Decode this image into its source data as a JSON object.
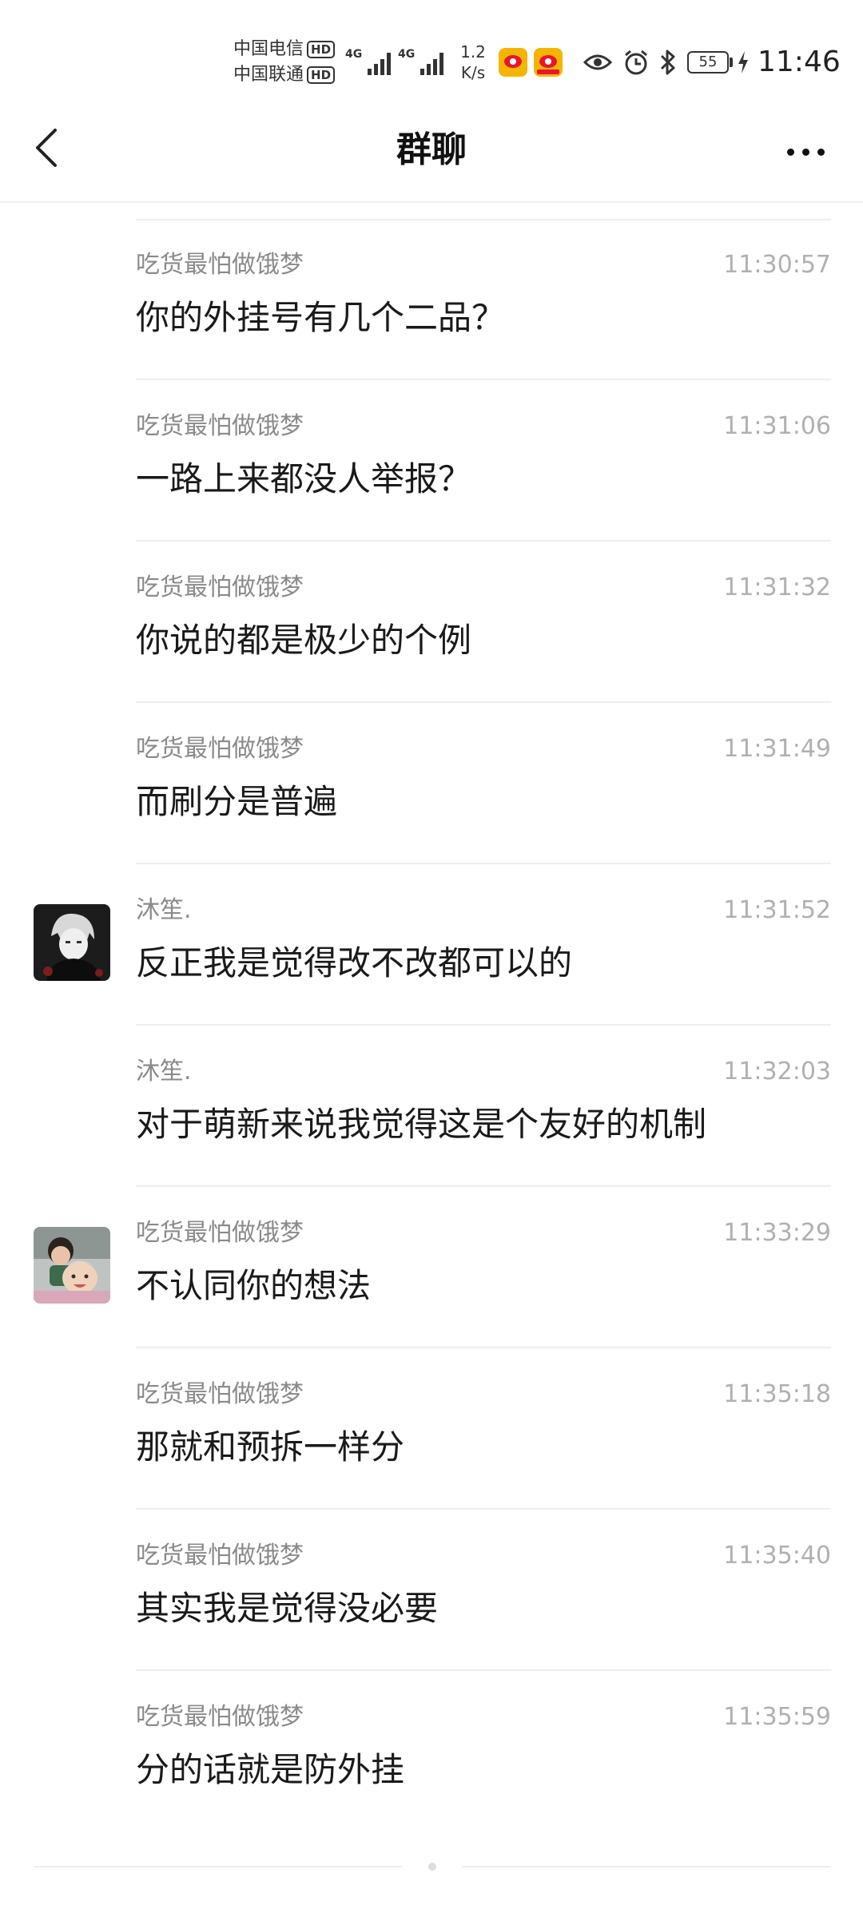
{
  "status_bar": {
    "carrier_1": "中国电信",
    "carrier_2": "中国联通",
    "hd_label": "HD",
    "network_type": "4G",
    "net_speed_value": "1.2",
    "net_speed_unit": "K/s",
    "battery": "55",
    "time": "11:46",
    "icons": [
      "weibo-icon",
      "weibo-icon",
      "eye-icon",
      "alarm-icon",
      "bluetooth-icon",
      "battery-icon",
      "charging-icon"
    ]
  },
  "nav": {
    "title": "群聊",
    "back_icon": "chevron-left-icon",
    "more_icon": "more-dots-icon"
  },
  "messages": [
    {
      "sender": "吃货最怕做饿梦",
      "time": "11:30:57",
      "text": "你的外挂号有几个二品？",
      "avatar": ""
    },
    {
      "sender": "吃货最怕做饿梦",
      "time": "11:31:06",
      "text": "一路上来都没人举报？",
      "avatar": ""
    },
    {
      "sender": "吃货最怕做饿梦",
      "time": "11:31:32",
      "text": "你说的都是极少的个例",
      "avatar": ""
    },
    {
      "sender": "吃货最怕做饿梦",
      "time": "11:31:49",
      "text": "而刷分是普遍",
      "avatar": ""
    },
    {
      "sender": "沐笙.",
      "time": "11:31:52",
      "text": "反正我是觉得改不改都可以的",
      "avatar": "dark-character-avatar"
    },
    {
      "sender": "沐笙.",
      "time": "11:32:03",
      "text": "对于萌新来说我觉得这是个友好的机制",
      "avatar": ""
    },
    {
      "sender": "吃货最怕做饿梦",
      "time": "11:33:29",
      "text": "不认同你的想法",
      "avatar": "kids-photo-avatar"
    },
    {
      "sender": "吃货最怕做饿梦",
      "time": "11:35:18",
      "text": "那就和预拆一样分",
      "avatar": ""
    },
    {
      "sender": "吃货最怕做饿梦",
      "time": "11:35:40",
      "text": "其实我是觉得没必要",
      "avatar": ""
    },
    {
      "sender": "吃货最怕做饿梦",
      "time": "11:35:59",
      "text": "分的话就是防外挂",
      "avatar": ""
    }
  ]
}
